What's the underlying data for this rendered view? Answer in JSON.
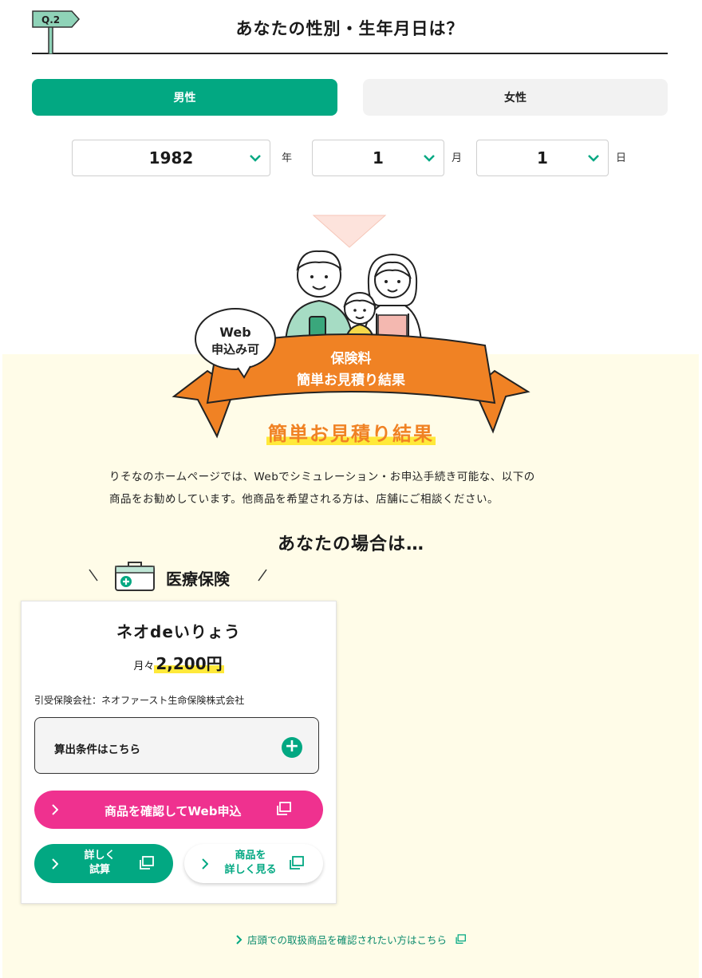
{
  "question": {
    "number": "Q.2",
    "title": "あなたの性別・生年月日は？"
  },
  "gender": {
    "male_label": "男性",
    "female_label": "女性",
    "selected": "男性"
  },
  "birthdate": {
    "year": "1982",
    "year_unit": "年",
    "month": "1",
    "month_unit": "月",
    "day": "1",
    "day_unit": "日"
  },
  "banner": {
    "badge_line1": "Web",
    "badge_line2": "申込み可",
    "ribbon_line1": "保険料",
    "ribbon_line2": "簡単お見積り結果"
  },
  "result": {
    "heading": "簡単お見積り結果",
    "intro_line1": "りそなのホームページでは、Webでシミュレーション・お申込手続き可能な、以下の",
    "intro_line2": "商品をお勧めしています。他商品を希望される方は、店舗にご相談ください。",
    "your_case": "あなたの場合は…",
    "category": "医療保険"
  },
  "product": {
    "name": "ネオdeいりょう",
    "price_unit": "月々",
    "price": "2,200円",
    "insurer": "引受保険会社：ネオファースト生命保険株式会社",
    "conditions_label": "算出条件はこちら",
    "apply_button": "商品を確認してWeb申込",
    "calc_line1": "詳しく",
    "calc_line2": "試算",
    "detail_line1": "商品を",
    "detail_line2": "詳しく見る"
  },
  "store_link": "店頭での取扱商品を確認されたい方はこちら",
  "colors": {
    "green": "#02a882",
    "pink": "#ef318f",
    "orange": "#f08224",
    "highlight": "#ffe93a",
    "cream": "#fffce8"
  }
}
